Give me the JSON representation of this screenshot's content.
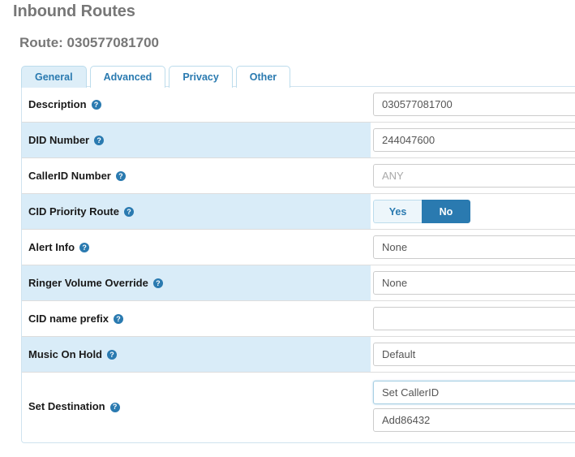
{
  "header": {
    "page_title": "Inbound Routes",
    "route_title": "Route: 030577081700"
  },
  "tabs": [
    {
      "label": "General",
      "active": true
    },
    {
      "label": "Advanced",
      "active": false
    },
    {
      "label": "Privacy",
      "active": false
    },
    {
      "label": "Other",
      "active": false
    }
  ],
  "help_glyph": "?",
  "form": {
    "rows": [
      {
        "label": "Description",
        "help": "?",
        "striped": false,
        "control": "text",
        "value": "030577081700",
        "placeholder": ""
      },
      {
        "label": "DID Number",
        "help": "?",
        "striped": true,
        "control": "text",
        "value": "244047600",
        "placeholder": ""
      },
      {
        "label": "CallerID Number",
        "help": "?",
        "striped": false,
        "control": "text",
        "value": "",
        "placeholder": "ANY"
      },
      {
        "label": "CID Priority Route",
        "help": "?",
        "striped": true,
        "control": "toggle",
        "options": [
          {
            "label": "Yes",
            "selected": false
          },
          {
            "label": "No",
            "selected": true
          }
        ]
      },
      {
        "label": "Alert Info",
        "help": "?",
        "striped": false,
        "control": "select",
        "value": "None"
      },
      {
        "label": "Ringer Volume Override",
        "help": "?",
        "striped": true,
        "control": "select",
        "value": "None"
      },
      {
        "label": "CID name prefix",
        "help": "?",
        "striped": false,
        "control": "text",
        "value": "",
        "placeholder": ""
      },
      {
        "label": "Music On Hold",
        "help": "?",
        "striped": true,
        "control": "select",
        "value": "Default"
      },
      {
        "label": "Set Destination",
        "help": "?",
        "striped": false,
        "tall": true,
        "control": "dual-select",
        "value": "Set CallerID",
        "value2": "Add86432",
        "focused": true
      }
    ]
  },
  "colors": {
    "accent": "#2a7ab0",
    "stripe": "#d9ecf8",
    "panel_border": "#cfe3ef",
    "heading": "#777777",
    "field_text": "#555555",
    "placeholder": "#a9a9a9"
  }
}
